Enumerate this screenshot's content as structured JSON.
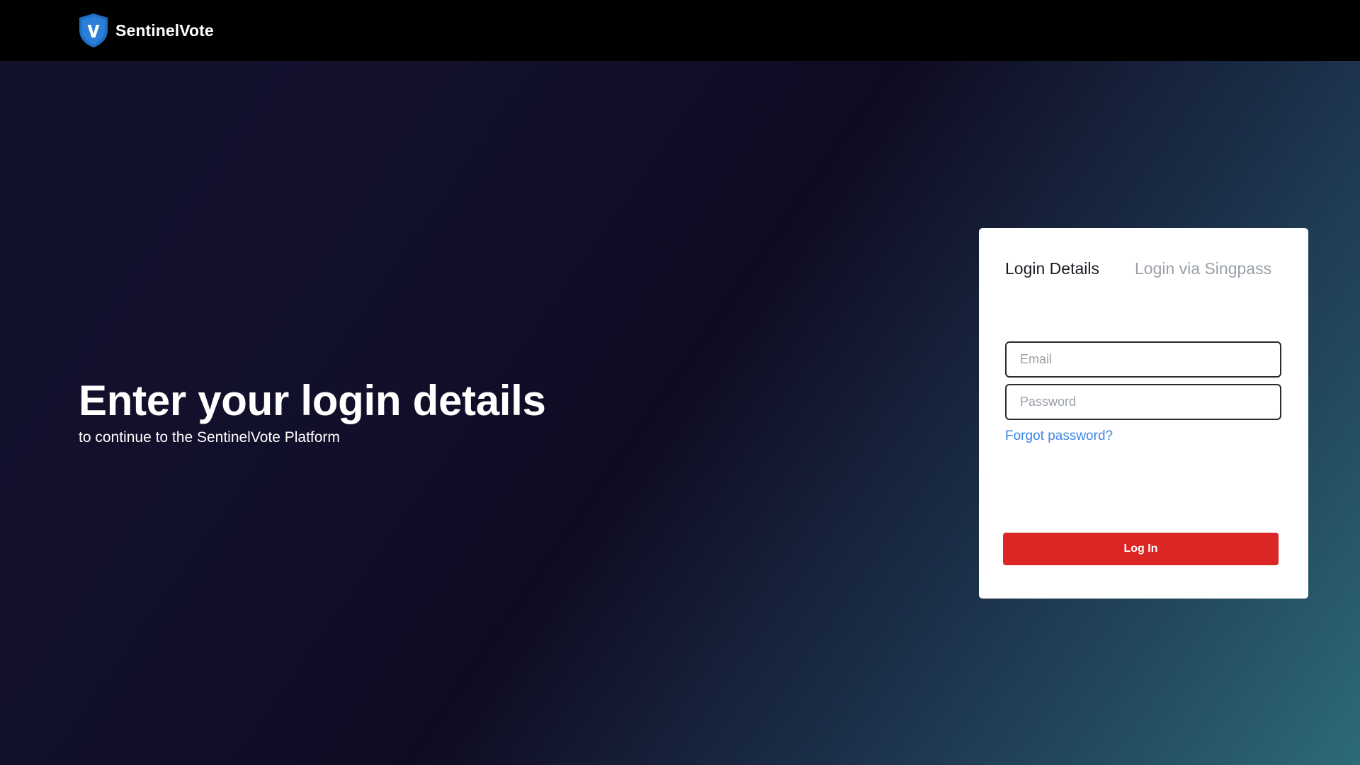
{
  "header": {
    "brand_name": "SentinelVote",
    "logo_letter": "V"
  },
  "hero": {
    "title": "Enter your login details",
    "subtitle": "to continue to the SentinelVote Platform"
  },
  "login_card": {
    "tabs": [
      {
        "label": "Login Details",
        "active": true
      },
      {
        "label": "Login via Singpass",
        "active": false
      }
    ],
    "email": {
      "value": "",
      "placeholder": "Email"
    },
    "password": {
      "value": "",
      "placeholder": "Password"
    },
    "forgot_password_label": "Forgot password?",
    "submit_label": "Log In"
  },
  "colors": {
    "primary_button": "#dc2626",
    "link": "#3d86e6",
    "shield_blue": "#1f6fc5",
    "topbar": "#000000"
  },
  "icons": {
    "logo": "shield-v-icon"
  }
}
